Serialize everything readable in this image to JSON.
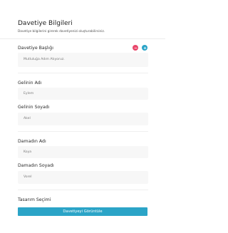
{
  "header": {
    "title": "Davetiye Bilgileri",
    "subtitle": "Davetiye bilgilerini girerek davetiyenizi oluşturabilirsiniz."
  },
  "invitation_title": {
    "label": "Davetiye Başlığı",
    "value": "Mutluluğa Adım Atıyoruz.",
    "actions": [
      {
        "icon": "remove-icon",
        "color": "#e9476b"
      },
      {
        "icon": "add-icon",
        "color": "#2ba4c7"
      }
    ]
  },
  "bride": {
    "first_name": {
      "label": "Gelinin Adı",
      "value": "Eylem"
    },
    "last_name": {
      "label": "Gelinin Soyadı",
      "value": "Akel"
    }
  },
  "groom": {
    "first_name": {
      "label": "Damadın Adı",
      "value": "Koya"
    },
    "last_name": {
      "label": "Damadın Soyadı",
      "value": "Vorel"
    }
  },
  "design": {
    "label": "Tasarım Seçimi"
  },
  "actions": {
    "preview_label": "Davetiyeyi Görüntüle"
  }
}
